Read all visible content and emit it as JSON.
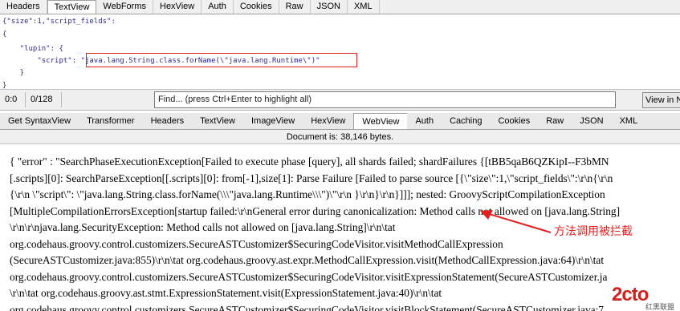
{
  "top_tabs": [
    "Headers",
    "TextView",
    "WebForms",
    "HexView",
    "Auth",
    "Cookies",
    "Raw",
    "JSON",
    "XML"
  ],
  "top_active": 1,
  "editor_lines": [
    "{\"size\":1,\"script_fields\":",
    "{",
    "    \"lupin\": {",
    "        \"script\": \"java.lang.String.class.forName(\\\"java.lang.Runtime\\\")\"",
    "    }",
    "}"
  ],
  "status": {
    "position": "0:0",
    "count": "0/128",
    "find_placeholder": "Find... (press Ctrl+Enter to highlight all)",
    "view_button": "View in N"
  },
  "bottom_tabs": [
    "Get SyntaxView",
    "Transformer",
    "Headers",
    "TextView",
    "ImageView",
    "HexView",
    "WebView",
    "Auth",
    "Caching",
    "Cookies",
    "Raw",
    "JSON",
    "XML"
  ],
  "bottom_active": 6,
  "doc_info": "Document is: 38,146 bytes.",
  "content_lines": [
    "{ \"error\" : \"SearchPhaseExecutionException[Failed to execute phase [query], all shards failed; shardFailures {[tBB5qaB6QZKipI--F3bMN",
    "[.scripts][0]: SearchParseException[[.scripts][0]: from[-1],size[1]: Parse Failure [Failed to parse source [{\\\"size\\\":1,\\\"script_fields\\\":\\r\\n{\\r\\n",
    "{\\r\\n \\\"script\\\": \\\"java.lang.String.class.forName(\\\\\\\"java.lang.Runtime\\\\\\\")\\\"\\r\\n }\\r\\n}\\r\\n}]]]; nested: GroovyScriptCompilationException",
    "[MultipleCompilationErrorsException[startup failed:\\r\\nGeneral error during canonicalization: Method calls not allowed on [java.lang.String]",
    "\\r\\n\\r\\njava.lang.SecurityException: Method calls not allowed on [java.lang.String]\\r\\n\\tat",
    "org.codehaus.groovy.control.customizers.SecureASTCustomizer$SecuringCodeVisitor.visitMethodCallExpression",
    "(SecureASTCustomizer.java:855)\\r\\n\\tat org.codehaus.groovy.ast.expr.MethodCallExpression.visit(MethodCallExpression.java:64)\\r\\n\\tat",
    "org.codehaus.groovy.control.customizers.SecureASTCustomizer$SecuringCodeVisitor.visitExpressionStatement(SecureASTCustomizer.ja",
    "\\r\\n\\tat org.codehaus.groovy.ast.stmt.ExpressionStatement.visit(ExpressionStatement.java:40)\\r\\n\\tat",
    "org.codehaus.groovy.control.customizers.SecureASTCustomizer$SecuringCodeVisitor.visitBlockStatement(SecureASTCustomizer.java:7"
  ],
  "annotation": "方法调用被拦截",
  "watermark": {
    "brand": "2cto",
    "sub": "红黑联盟"
  },
  "colors": {
    "annotation": "#e02020",
    "editor_text": "#2b2b8c",
    "watermark": "#d12020"
  }
}
